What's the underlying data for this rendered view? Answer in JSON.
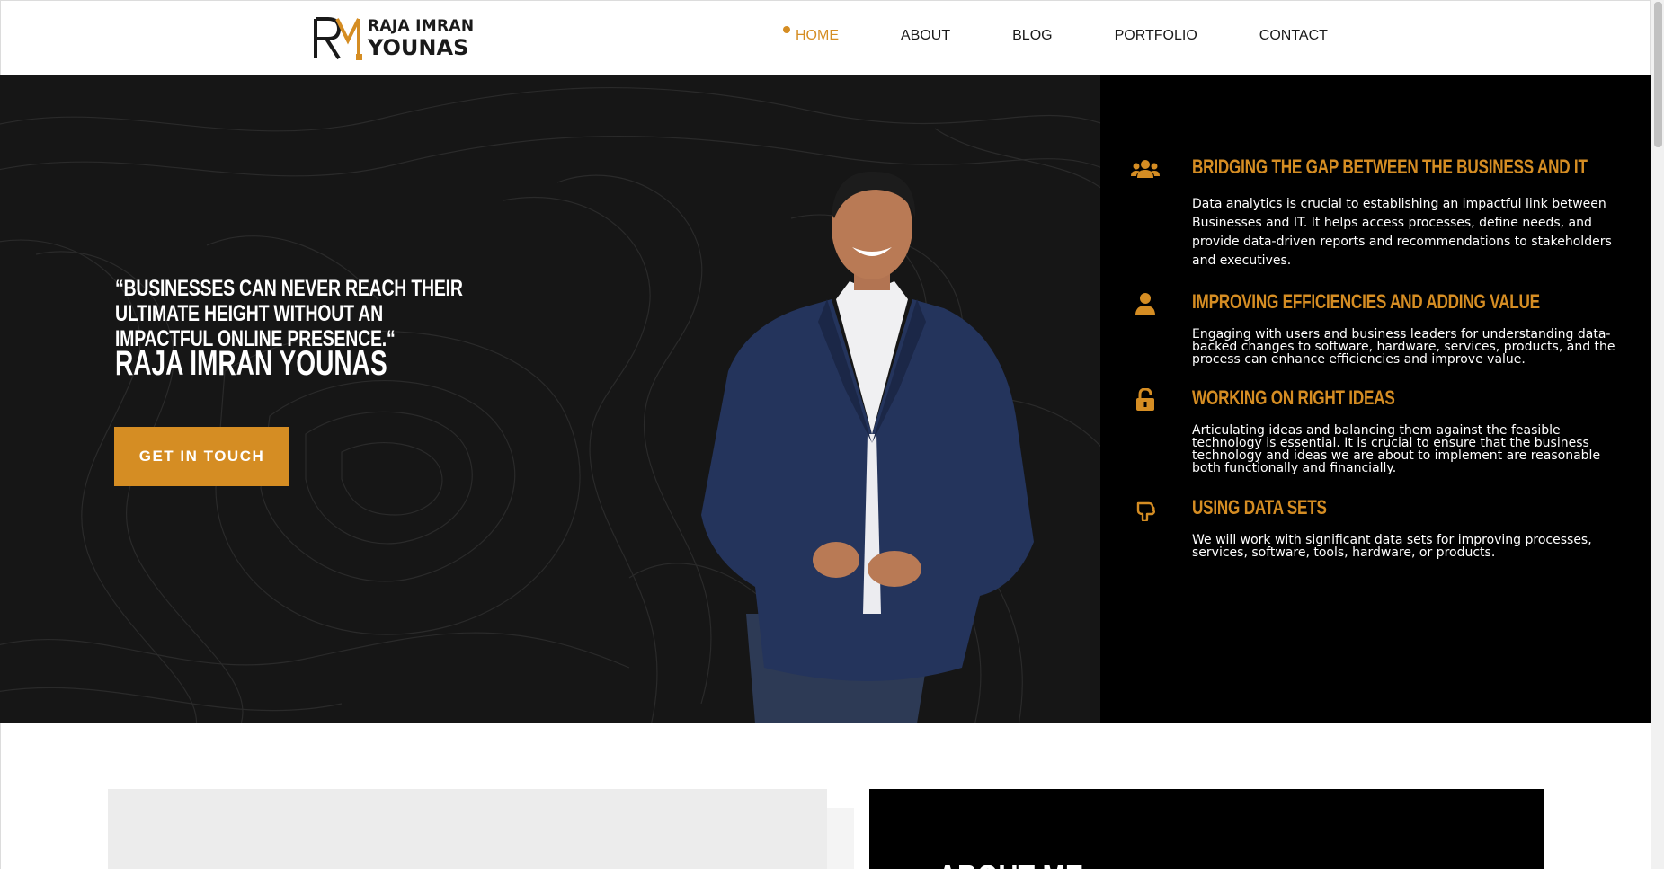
{
  "header": {
    "logo": {
      "monogram": "RY",
      "line1": "RAJA IMRAN",
      "line2": "YOUNAS"
    },
    "nav": [
      {
        "label": "HOME",
        "active": true
      },
      {
        "label": "ABOUT",
        "active": false
      },
      {
        "label": "BLOG",
        "active": false
      },
      {
        "label": "PORTFOLIO",
        "active": false
      },
      {
        "label": "CONTACT",
        "active": false
      }
    ]
  },
  "hero": {
    "quote": "“BUSINESSES CAN NEVER REACH THEIR ULTIMATE HEIGHT WITHOUT AN IMPACTFUL ONLINE PRESENCE.“",
    "name": "RAJA IMRAN YOUNAS",
    "cta_label": "GET IN TOUCH"
  },
  "features": [
    {
      "icon": "users-icon",
      "title": "BRIDGING THE GAP BETWEEN THE BUSINESS AND IT",
      "text": "Data analytics is crucial to establishing an impactful link between Businesses and IT. It helps access processes, define needs, and provide data-driven reports and recommendations to stakeholders and executives."
    },
    {
      "icon": "user-icon",
      "title": "IMPROVING EFFICIENCIES AND ADDING VALUE",
      "text": "Engaging with users and business leaders for understanding data-backed changes to software, hardware, services, products, and the process can enhance efficiencies and improve value."
    },
    {
      "icon": "unlock-icon",
      "title": "WORKING ON RIGHT IDEAS",
      "text": "Articulating ideas and balancing them against the feasible technology is essential. It is crucial to ensure that the business technology and ideas we are about to implement are reasonable both functionally and financially."
    },
    {
      "icon": "hand-pointer-icon",
      "title": "USING DATA SETS",
      "text": "We will work with significant data sets for improving processes, services, software, tools, hardware, or products."
    }
  ],
  "about": {
    "heading": "ABOUT ME"
  },
  "colors": {
    "accent": "#d58d23",
    "dark": "#161616",
    "black": "#000000"
  }
}
